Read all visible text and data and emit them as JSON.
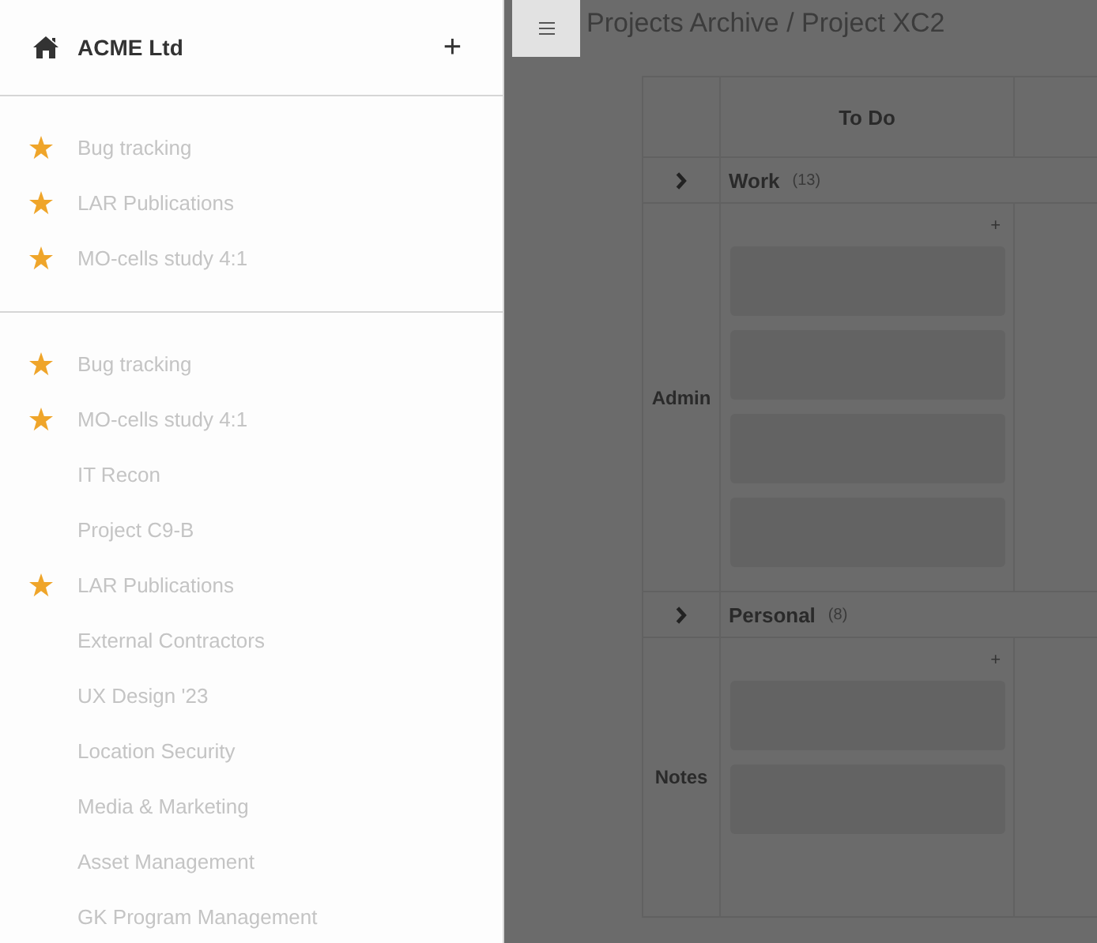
{
  "sidebar": {
    "title": "ACME Ltd",
    "add_label": "+",
    "favorites": [
      {
        "name": "Bug tracking",
        "starred": true
      },
      {
        "name": "LAR Publications",
        "starred": true
      },
      {
        "name": "MO-cells study 4:1",
        "starred": true
      }
    ],
    "projects": [
      {
        "name": "Bug tracking",
        "starred": true
      },
      {
        "name": "MO-cells study 4:1",
        "starred": true
      },
      {
        "name": "IT Recon",
        "starred": false
      },
      {
        "name": "Project C9-B",
        "starred": false
      },
      {
        "name": "LAR Publications",
        "starred": true
      },
      {
        "name": "External Contractors",
        "starred": false
      },
      {
        "name": "UX Design '23",
        "starred": false
      },
      {
        "name": "Location Security",
        "starred": false
      },
      {
        "name": "Media & Marketing",
        "starred": false
      },
      {
        "name": "Asset Management",
        "starred": false
      },
      {
        "name": "GK Program Management",
        "starred": false
      }
    ]
  },
  "main": {
    "breadcrumb": "Projects Archive / Project XC2",
    "columns": [
      "To Do"
    ],
    "groups": [
      {
        "name": "Work",
        "count": "(13)",
        "lane": {
          "name": "Admin",
          "add_label": "+",
          "cards": [
            {
              "kind": "blank"
            },
            {
              "kind": "blank"
            },
            {
              "kind": "blank"
            },
            {
              "kind": "blank"
            }
          ]
        }
      },
      {
        "name": "Personal",
        "count": "(8)",
        "lane": {
          "name": "Notes",
          "add_label": "+",
          "cards": [
            {
              "kind": "blank"
            },
            {
              "kind": "blank"
            }
          ]
        }
      }
    ]
  }
}
